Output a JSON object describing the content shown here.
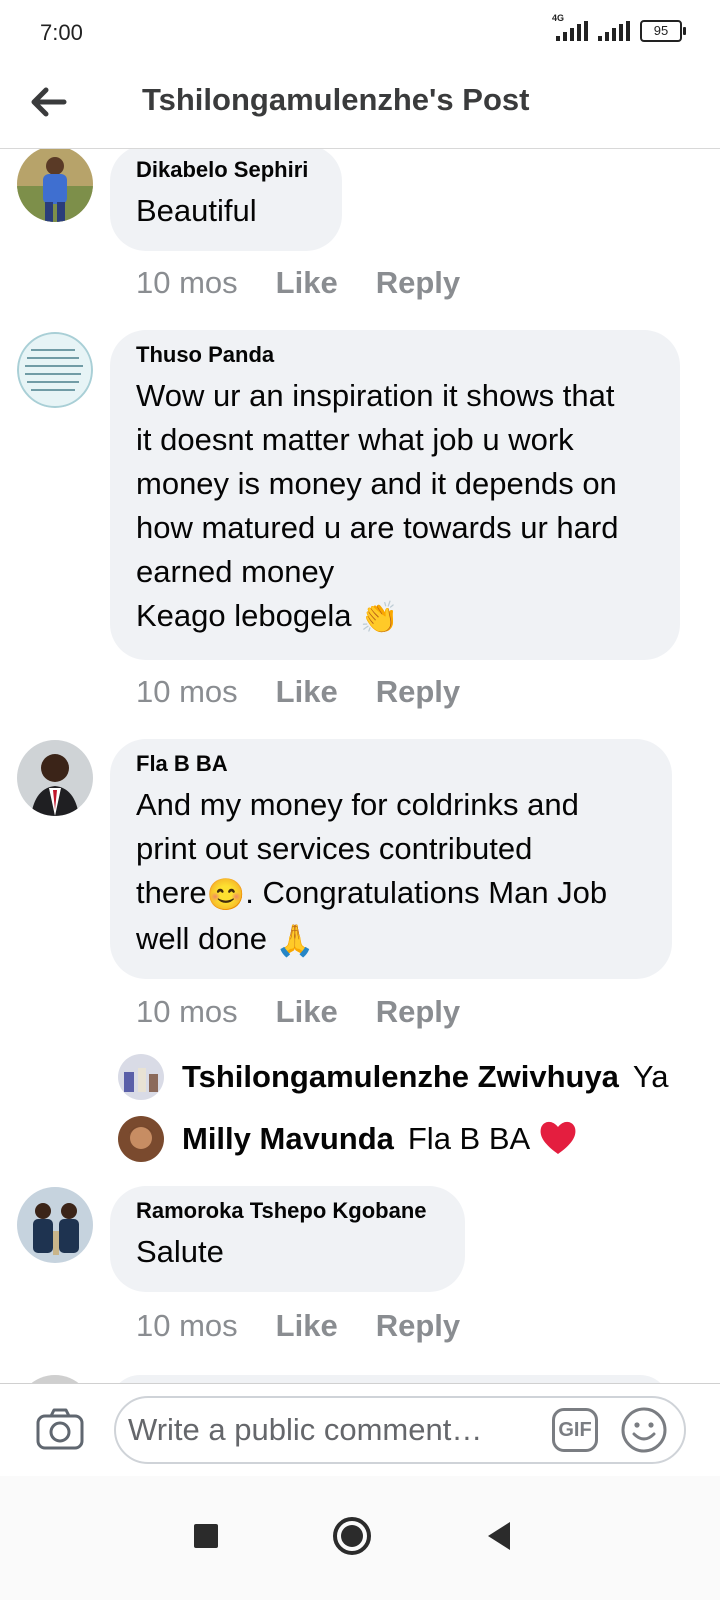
{
  "status_bar": {
    "time": "7:00",
    "network": "4G",
    "battery": "95"
  },
  "header": {
    "title": "Tshilongamulenzhe's Post"
  },
  "comments": [
    {
      "author": "Dikabelo Sephiri",
      "text": "Beautiful",
      "time": "10 mos",
      "like": "Like",
      "reply": "Reply"
    },
    {
      "author": "Thuso Panda",
      "text": "Wow ur an inspiration it shows that\nit doesnt matter what job u work\nmoney is money and it depends on\nhow matured u are towards ur hard\nearned money\nKeago lebogela",
      "emoji": "👏",
      "time": "10 mos",
      "like": "Like",
      "reply": "Reply"
    },
    {
      "author": "Fla B BA",
      "text_1": "And my money for coldrinks and\nprint out services contributed\nthere",
      "emoji_1": "😊",
      "text_2": ". Congratulations Man Job\nwell done ",
      "emoji_2": "🙏",
      "time": "10 mos",
      "like": "Like",
      "reply": "Reply",
      "replies": [
        {
          "author": "Tshilongamulenzhe Zwivhuya",
          "text": "Ya"
        },
        {
          "author": "Milly Mavunda",
          "text": "Fla B BA",
          "emoji": "❤️"
        }
      ]
    },
    {
      "author": "Ramoroka Tshepo Kgobane",
      "text": "Salute",
      "time": "10 mos",
      "like": "Like",
      "reply": "Reply"
    }
  ],
  "composer": {
    "placeholder": "Write a public comment…",
    "gif_label": "GIF"
  },
  "colors": {
    "bubble": "#f0f2f5",
    "meta_gray": "#8a8d91",
    "heart": "#e41e3f"
  },
  "icons": [
    "back-arrow-icon",
    "camera-icon",
    "gif-icon",
    "smiley-icon",
    "square-icon",
    "circle-home-icon",
    "triangle-back-icon"
  ]
}
